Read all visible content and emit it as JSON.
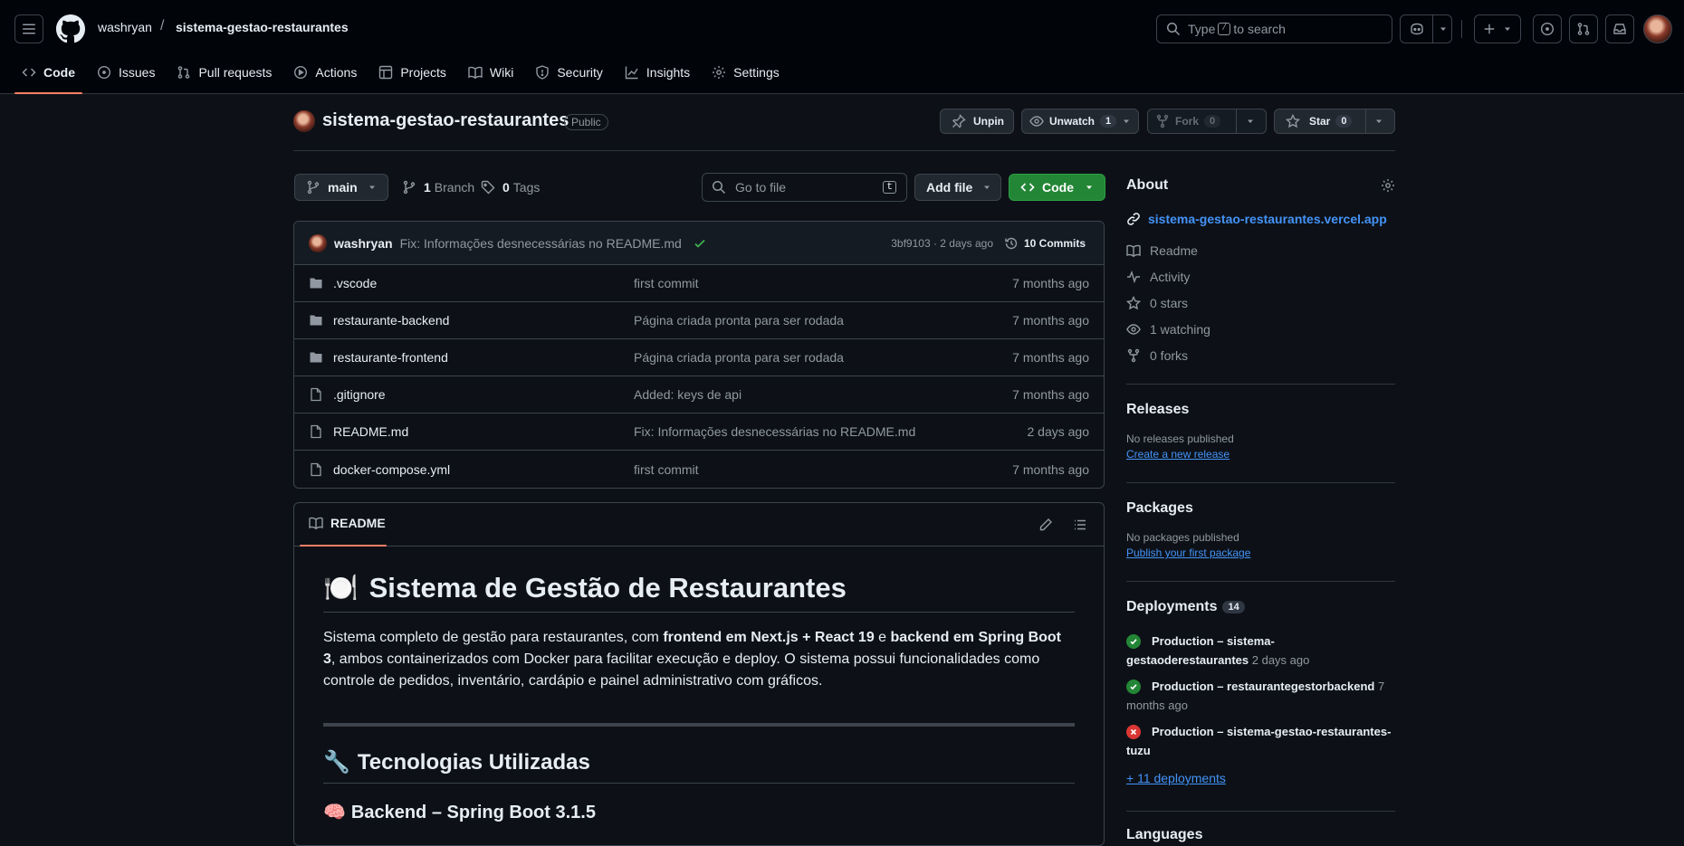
{
  "header": {
    "owner": "washryan",
    "separator": "/",
    "repo": "sistema-gestao-restaurantes",
    "search_prefix": "Type",
    "search_key": "/",
    "search_suffix": "to search"
  },
  "tabs": [
    {
      "label": "Code",
      "icon": "code-icon"
    },
    {
      "label": "Issues",
      "icon": "issue-icon"
    },
    {
      "label": "Pull requests",
      "icon": "pull-request-icon"
    },
    {
      "label": "Actions",
      "icon": "play-icon"
    },
    {
      "label": "Projects",
      "icon": "table-icon"
    },
    {
      "label": "Wiki",
      "icon": "book-icon"
    },
    {
      "label": "Security",
      "icon": "shield-icon"
    },
    {
      "label": "Insights",
      "icon": "graph-icon"
    },
    {
      "label": "Settings",
      "icon": "gear-icon"
    }
  ],
  "repo_head": {
    "name": "sistema-gestao-restaurantes",
    "visibility": "Public",
    "unpin": "Unpin",
    "unwatch": "Unwatch",
    "watch_count": "1",
    "fork": "Fork",
    "fork_count": "0",
    "star": "Star",
    "star_count": "0"
  },
  "toolbar": {
    "branch": "main",
    "branches_count": "1",
    "branches_label": "Branch",
    "tags_count": "0",
    "tags_label": "Tags",
    "goto_placeholder": "Go to file",
    "goto_key": "t",
    "add_file": "Add file",
    "code": "Code"
  },
  "latest_commit": {
    "author": "washryan",
    "message": "Fix: Informações desnecessárias no README.md",
    "hash_age": "3bf9103 · 2 days ago",
    "commits": "10 Commits"
  },
  "files": [
    {
      "name": ".vscode",
      "type": "folder",
      "message": "first commit",
      "age": "7 months ago"
    },
    {
      "name": "restaurante-backend",
      "type": "folder",
      "message": "Página criada pronta para ser rodada",
      "age": "7 months ago"
    },
    {
      "name": "restaurante-frontend",
      "type": "folder",
      "message": "Página criada pronta para ser rodada",
      "age": "7 months ago"
    },
    {
      "name": ".gitignore",
      "type": "file",
      "message": "Added: keys de api",
      "age": "7 months ago"
    },
    {
      "name": "README.md",
      "type": "file",
      "message": "Fix: Informações desnecessárias no README.md",
      "age": "2 days ago"
    },
    {
      "name": "docker-compose.yml",
      "type": "file",
      "message": "first commit",
      "age": "7 months ago"
    }
  ],
  "readme": {
    "tab": "README",
    "h1_emoji": "🍽️",
    "h1": "Sistema de Gestão de Restaurantes",
    "p_1": "Sistema completo de gestão para restaurantes, com ",
    "p_b1": "frontend em Next.js + React 19",
    "p_2": " e ",
    "p_b2": "backend em Spring Boot 3",
    "p_3": ", ambos containerizados com Docker para facilitar execução e deploy. O sistema possui funcionalidades como controle de pedidos, inventário, cardápio e painel administrativo com gráficos.",
    "h2_emoji": "🔧",
    "h2": "Tecnologias Utilizadas",
    "h3_emoji": "🧠",
    "h3": "Backend – Spring Boot 3.1.5"
  },
  "about": {
    "title": "About",
    "link": "sistema-gestao-restaurantes.vercel.app",
    "items": [
      {
        "icon": "book-icon",
        "text": "Readme"
      },
      {
        "icon": "pulse-icon",
        "text": "Activity"
      },
      {
        "icon": "star-icon",
        "text": "0 stars"
      },
      {
        "icon": "eye-icon",
        "text": "1 watching"
      },
      {
        "icon": "fork-icon",
        "text": "0 forks"
      }
    ]
  },
  "releases": {
    "title": "Releases",
    "empty": "No releases published",
    "action": "Create a new release"
  },
  "packages": {
    "title": "Packages",
    "empty": "No packages published",
    "action": "Publish your first package"
  },
  "deployments": {
    "title": "Deployments",
    "count": "14",
    "items": [
      {
        "name": "Production – sistema-gestaoderestaurantes",
        "age": "2 days ago",
        "status": "success"
      },
      {
        "name": "Production – restaurantegestorbackend",
        "age": "7 months ago",
        "status": "success"
      },
      {
        "name": "Production – sistema-gestao-restaurantes-tuzu",
        "age": "",
        "status": "failure"
      }
    ],
    "more": "+ 11 deployments"
  },
  "languages": {
    "title": "Languages"
  },
  "colors": {
    "accent": "#f78166",
    "link": "#4493f8",
    "success": "#238636",
    "failure": "#da3633"
  }
}
